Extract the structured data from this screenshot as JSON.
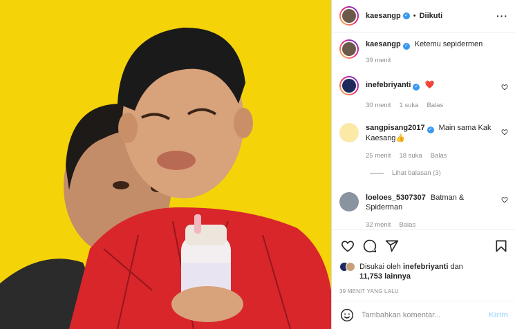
{
  "post": {
    "author": "kaesangp",
    "follow_status": "Diikuti",
    "caption": "Ketemu sepidermen",
    "caption_time": "39 menit"
  },
  "comments": [
    {
      "user": "inefebriyanti",
      "verified": true,
      "text": "❤️",
      "time": "30 menit",
      "likes": "1 suka",
      "reply": "Balas"
    },
    {
      "user": "sangpisang2017",
      "verified": true,
      "text": "Main sama Kak Kaesang👍",
      "time": "25 menit",
      "likes": "18 suka",
      "reply": "Balas",
      "view_replies": "Lihat balasan (3)"
    },
    {
      "user": "loeloes_5307307",
      "verified": false,
      "text": "Batman & Spiderman",
      "time": "32 menit",
      "likes": "",
      "reply": "Balas"
    }
  ],
  "likes": {
    "prefix": "Disukai oleh ",
    "user": "inefebriyanti",
    "middle": " dan",
    "count": "11,753 lainnya"
  },
  "post_time": "39 MENIT YANG LALU",
  "add_comment": {
    "placeholder": "Tambahkan komentar...",
    "post_label": "Kirim"
  },
  "colors": {
    "verified": "#3897f0",
    "background_photo": "#f6d60c",
    "post_button_disabled": "#b2dffc"
  },
  "icons": {
    "more": "more-icon",
    "like": "heart-icon",
    "comment": "comment-icon",
    "share": "share-icon",
    "save": "bookmark-icon",
    "emoji": "emoji-icon"
  }
}
